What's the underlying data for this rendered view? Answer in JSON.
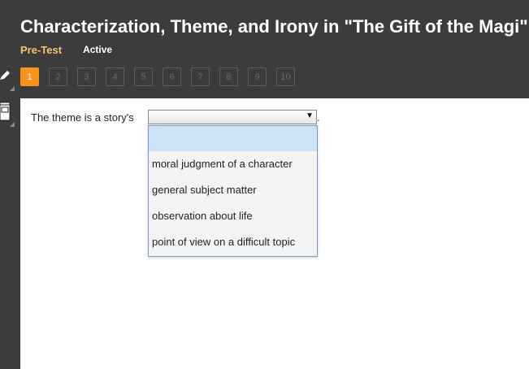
{
  "header": {
    "title": "Characterization, Theme, and Irony in \"The Gift of the Magi\"",
    "mode": "Pre-Test",
    "status": "Active"
  },
  "question_nav": {
    "items": [
      "1",
      "2",
      "3",
      "4",
      "5",
      "6",
      "7",
      "8",
      "9",
      "10"
    ],
    "active": "1"
  },
  "toolbar": {
    "tools": [
      "pencil-icon",
      "notepad-icon"
    ]
  },
  "question": {
    "prompt": "The theme is a story's",
    "selected_value": "",
    "trailing": ".",
    "options": [
      "",
      "moral judgment of a character",
      "general subject matter",
      "observation about life",
      "point of view on a difficult topic"
    ]
  },
  "colors": {
    "header_bg": "#3c3c3c",
    "accent_orange": "#f7941d",
    "pretest_gold": "#f0c56c",
    "option_highlight": "#cde2f7"
  }
}
